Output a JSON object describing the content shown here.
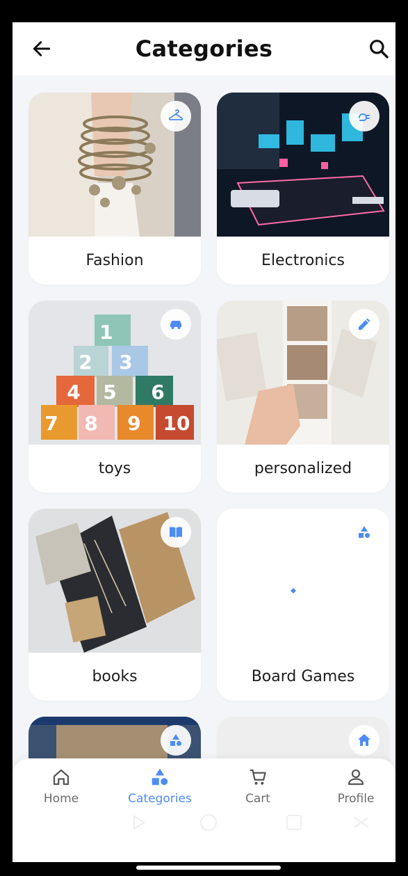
{
  "header": {
    "title": "Categories",
    "back_icon": "arrow-left-icon",
    "search_icon": "search-icon"
  },
  "categories": [
    {
      "label": "Fashion",
      "icon": "hanger-icon"
    },
    {
      "label": "Electronics",
      "icon": "plug-icon"
    },
    {
      "label": "toys",
      "icon": "car-icon"
    },
    {
      "label": "personalized",
      "icon": "pencil-icon"
    },
    {
      "label": "books",
      "icon": "book-icon"
    },
    {
      "label": "Board Games",
      "icon": "shapes-icon"
    },
    {
      "label": "",
      "icon": "shapes-icon"
    },
    {
      "label": "",
      "icon": "home-icon"
    }
  ],
  "nav": {
    "items": [
      {
        "label": "Home",
        "icon": "home-outline-icon"
      },
      {
        "label": "Categories",
        "icon": "shapes-icon"
      },
      {
        "label": "Cart",
        "icon": "cart-icon"
      },
      {
        "label": "Profile",
        "icon": "person-icon"
      }
    ],
    "active": "Categories"
  },
  "colors": {
    "accent": "#4d8cf5",
    "background": "#f4f5f8",
    "card": "#ffffff"
  }
}
